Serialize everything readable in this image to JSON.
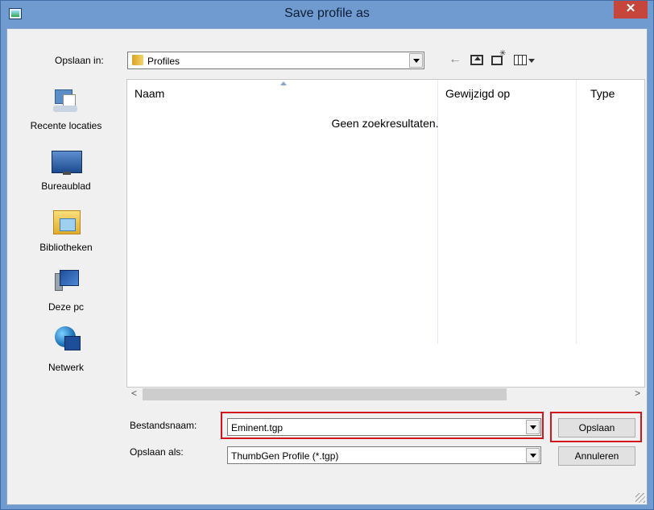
{
  "window": {
    "title": "Save profile as",
    "close_glyph": "✕"
  },
  "toolbar": {
    "save_in_label": "Opslaan in:",
    "current_folder": "Profiles",
    "back_glyph": "←"
  },
  "places": [
    {
      "label": "Recente locaties",
      "icon": "recent-locations-icon"
    },
    {
      "label": "Bureaublad",
      "icon": "desktop-icon"
    },
    {
      "label": "Bibliotheken",
      "icon": "libraries-icon"
    },
    {
      "label": "Deze pc",
      "icon": "this-pc-icon"
    },
    {
      "label": "Netwerk",
      "icon": "network-icon"
    }
  ],
  "listview": {
    "columns": [
      "Naam",
      "Gewijzigd op",
      "Type"
    ],
    "empty_message": "Geen zoekresultaten."
  },
  "scrollbar": {
    "left_glyph": "<",
    "right_glyph": ">"
  },
  "form": {
    "filename_label": "Bestandsnaam:",
    "filename_value": "Eminent.tgp",
    "filetype_label": "Opslaan als:",
    "filetype_value": "ThumbGen Profile (*.tgp)"
  },
  "buttons": {
    "save": "Opslaan",
    "cancel": "Annuleren"
  },
  "colors": {
    "highlight": "#d4141b",
    "titlebar": "#6f9bd1",
    "close": "#c7463b"
  }
}
